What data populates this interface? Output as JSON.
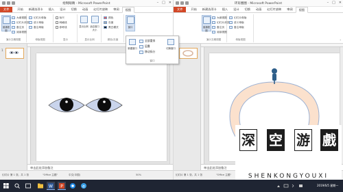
{
  "left_window": {
    "title": "绘制眼睛 - Microsoft PowerPoint",
    "window_buttons": [
      "–",
      "□",
      "✕"
    ],
    "tabs": [
      "文件",
      "开始",
      "新建选项卡",
      "插入",
      "设计",
      "切换",
      "动画",
      "幻灯片放映",
      "审阅",
      "视图"
    ],
    "active_tab": "视图",
    "ribbon": {
      "views_group": {
        "label": "演示文稿视图",
        "normal": "普通视图",
        "outline": "大纲视图",
        "sorter": "幻灯片浏览",
        "notes": "备注页",
        "reading": "阅读视图"
      },
      "master_group": {
        "label": "母版视图",
        "slide_master": "幻灯片母版",
        "handout_master": "讲义母版",
        "notes_master": "备注母版"
      },
      "show_group": {
        "label": "显示",
        "ruler": "标尺",
        "gridlines": "网格线",
        "guides": "参考线"
      },
      "zoom_group": {
        "label": "显示比例",
        "zoom": "显示比例",
        "fit": "适应窗口大小"
      },
      "color_group": {
        "label": "颜色/灰度",
        "color": "颜色",
        "grayscale": "灰度",
        "bw": "黑白模式"
      },
      "window_group": {
        "label": "窗口",
        "button": "窗口"
      }
    },
    "slide_number": "1",
    "notes_placeholder": "单击此处添加备注",
    "status": {
      "slide": "幻灯片 第 1 张，共 1 张",
      "theme": "\"Office 主题\"",
      "lang": "中文(中国)",
      "zoom": "50%"
    }
  },
  "window_dropdown": {
    "new_window": "新建窗口",
    "arrange_all": "全部重排",
    "cascade": "层叠",
    "move_split": "移动拆分",
    "switch_windows": "切换窗口",
    "label": "窗口"
  },
  "right_window": {
    "title": "环形圈圈 - Microsoft PowerPoint",
    "window_buttons": [
      "–",
      "□",
      "✕"
    ],
    "tabs": [
      "文件",
      "开始",
      "新建选项卡",
      "插入",
      "设计",
      "切换",
      "动画",
      "幻灯片放映",
      "审阅",
      "视图"
    ],
    "active_tab": "视图",
    "ribbon": {
      "normal": "普通视图",
      "outline": "大纲视图",
      "sorter": "幻灯片浏览",
      "notes": "备注页",
      "reading": "阅读视图",
      "slide_master": "幻灯片母版",
      "handout_master": "讲义母版",
      "notes_master": "备注母版",
      "views_label": "演示文稿视图",
      "master_label": "母版视图"
    },
    "slide_number": "1",
    "notes_placeholder": "单击此处添加备注",
    "status": {
      "slide": "幻灯片 第 1 张，共 1 张",
      "theme": "\"Office 主题\"",
      "lang": "中文(中国)"
    }
  },
  "watermark": {
    "chars": [
      "深",
      "空",
      "游",
      "戲"
    ],
    "subtitle": "SHENKONGYOUXI"
  },
  "taskbar": {
    "clock_date": "2019/6/5 星期一"
  },
  "colors": {
    "file_tab": "#d24726",
    "eye_fill": "#c9d4ec",
    "ring_fill": "#fbe1cd",
    "ring_stroke": "#9ab0d3",
    "pin": "#2f5f8a",
    "taskbar": "#1f2533"
  }
}
